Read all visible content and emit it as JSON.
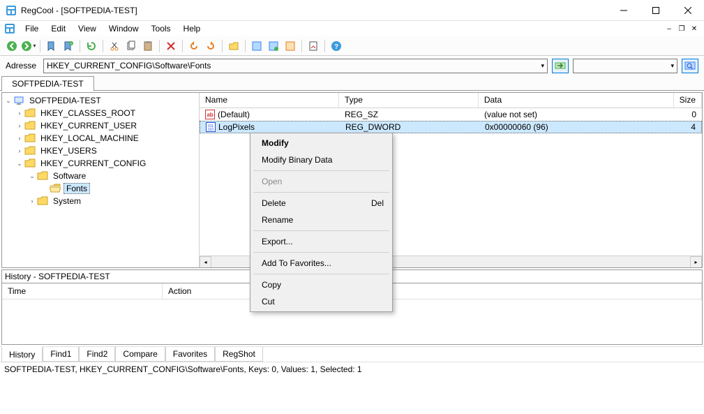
{
  "window": {
    "title": "RegCool - [SOFTPEDIA-TEST]"
  },
  "menu": {
    "items": [
      "File",
      "Edit",
      "View",
      "Window",
      "Tools",
      "Help"
    ]
  },
  "address": {
    "label": "Adresse",
    "value": "HKEY_CURRENT_CONFIG\\Software\\Fonts"
  },
  "top_tab": {
    "label": "SOFTPEDIA-TEST"
  },
  "tree": {
    "root": "SOFTPEDIA-TEST",
    "hives": [
      "HKEY_CLASSES_ROOT",
      "HKEY_CURRENT_USER",
      "HKEY_LOCAL_MACHINE",
      "HKEY_USERS",
      "HKEY_CURRENT_CONFIG"
    ],
    "software": "Software",
    "fonts": "Fonts",
    "system": "System"
  },
  "list": {
    "headers": {
      "name": "Name",
      "type": "Type",
      "data": "Data",
      "size": "Size"
    },
    "rows": [
      {
        "name": "(Default)",
        "type": "REG_SZ",
        "data": "(value not set)",
        "size": "0"
      },
      {
        "name": "LogPixels",
        "type": "REG_DWORD",
        "data": "0x00000060 (96)",
        "size": "4"
      }
    ]
  },
  "context_menu": {
    "modify": "Modify",
    "modify_binary": "Modify Binary Data",
    "open": "Open",
    "delete": "Delete",
    "delete_key": "Del",
    "rename": "Rename",
    "export": "Export...",
    "favorites": "Add To Favorites...",
    "copy": "Copy",
    "cut": "Cut"
  },
  "history": {
    "title": "History - SOFTPEDIA-TEST",
    "cols": {
      "time": "Time",
      "action": "Action"
    }
  },
  "bottom_tabs": [
    "History",
    "Find1",
    "Find2",
    "Compare",
    "Favorites",
    "RegShot"
  ],
  "status": "SOFTPEDIA-TEST, HKEY_CURRENT_CONFIG\\Software\\Fonts, Keys: 0, Values: 1, Selected: 1"
}
